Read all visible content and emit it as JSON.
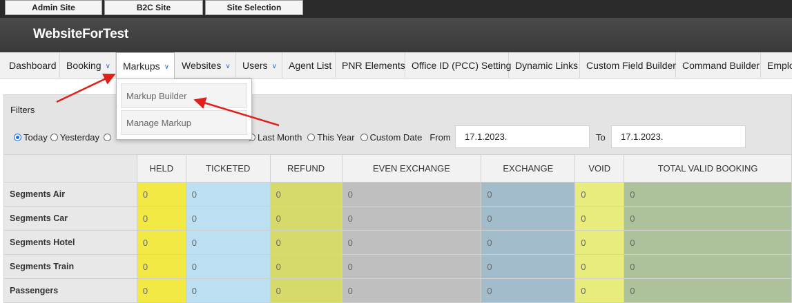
{
  "site_bar": {
    "buttons": [
      "Admin Site",
      "B2C Site",
      "Site Selection"
    ]
  },
  "header": {
    "brand": "WebsiteForTest"
  },
  "nav": {
    "items": [
      {
        "label": "Dashboard",
        "has_dropdown": false
      },
      {
        "label": "Booking",
        "has_dropdown": true
      },
      {
        "label": "Markups",
        "has_dropdown": true,
        "active": true
      },
      {
        "label": "Websites",
        "has_dropdown": true
      },
      {
        "label": "Users",
        "has_dropdown": true
      },
      {
        "label": "Agent List",
        "has_dropdown": false
      },
      {
        "label": "PNR Elements",
        "has_dropdown": false
      },
      {
        "label": "Office ID (PCC) Setting",
        "has_dropdown": false
      },
      {
        "label": "Dynamic Links",
        "has_dropdown": false
      },
      {
        "label": "Custom Field Builder",
        "has_dropdown": false
      },
      {
        "label": "Command Builder",
        "has_dropdown": false
      },
      {
        "label": "Emplo",
        "has_dropdown": false
      }
    ],
    "dropdown_icon": "chevron-down-icon"
  },
  "markups_menu": {
    "items": [
      "Markup Builder",
      "Manage Markup"
    ]
  },
  "filters": {
    "title": "Filters",
    "periods": [
      {
        "label": "Today",
        "checked": true
      },
      {
        "label": "Yesterday",
        "checked": false
      },
      {
        "label": "Last Month",
        "checked": false
      },
      {
        "label": "This Year",
        "checked": false
      },
      {
        "label": "Custom Date",
        "checked": false
      }
    ],
    "from_label": "From",
    "from_value": "17.1.2023.",
    "to_label": "To",
    "to_value": "17.1.2023."
  },
  "table": {
    "columns": [
      "HELD",
      "TICKETED",
      "REFUND",
      "EVEN EXCHANGE",
      "EXCHANGE",
      "VOID",
      "TOTAL VALID BOOKING"
    ],
    "column_colors": [
      "#f2e944",
      "#bcdff1",
      "#d5da6b",
      "#bfbfbf",
      "#a3bccb",
      "#e7ec7c",
      "#adc29b"
    ],
    "rows": [
      {
        "label": "Segments Air",
        "values": [
          "0",
          "0",
          "0",
          "0",
          "0",
          "0",
          "0"
        ]
      },
      {
        "label": "Segments Car",
        "values": [
          "0",
          "0",
          "0",
          "0",
          "0",
          "0",
          "0"
        ]
      },
      {
        "label": "Segments Hotel",
        "values": [
          "0",
          "0",
          "0",
          "0",
          "0",
          "0",
          "0"
        ]
      },
      {
        "label": "Segments Train",
        "values": [
          "0",
          "0",
          "0",
          "0",
          "0",
          "0",
          "0"
        ]
      },
      {
        "label": "Passengers",
        "values": [
          "0",
          "0",
          "0",
          "0",
          "0",
          "0",
          "0"
        ]
      }
    ]
  },
  "annotation_color": "#e0201b"
}
